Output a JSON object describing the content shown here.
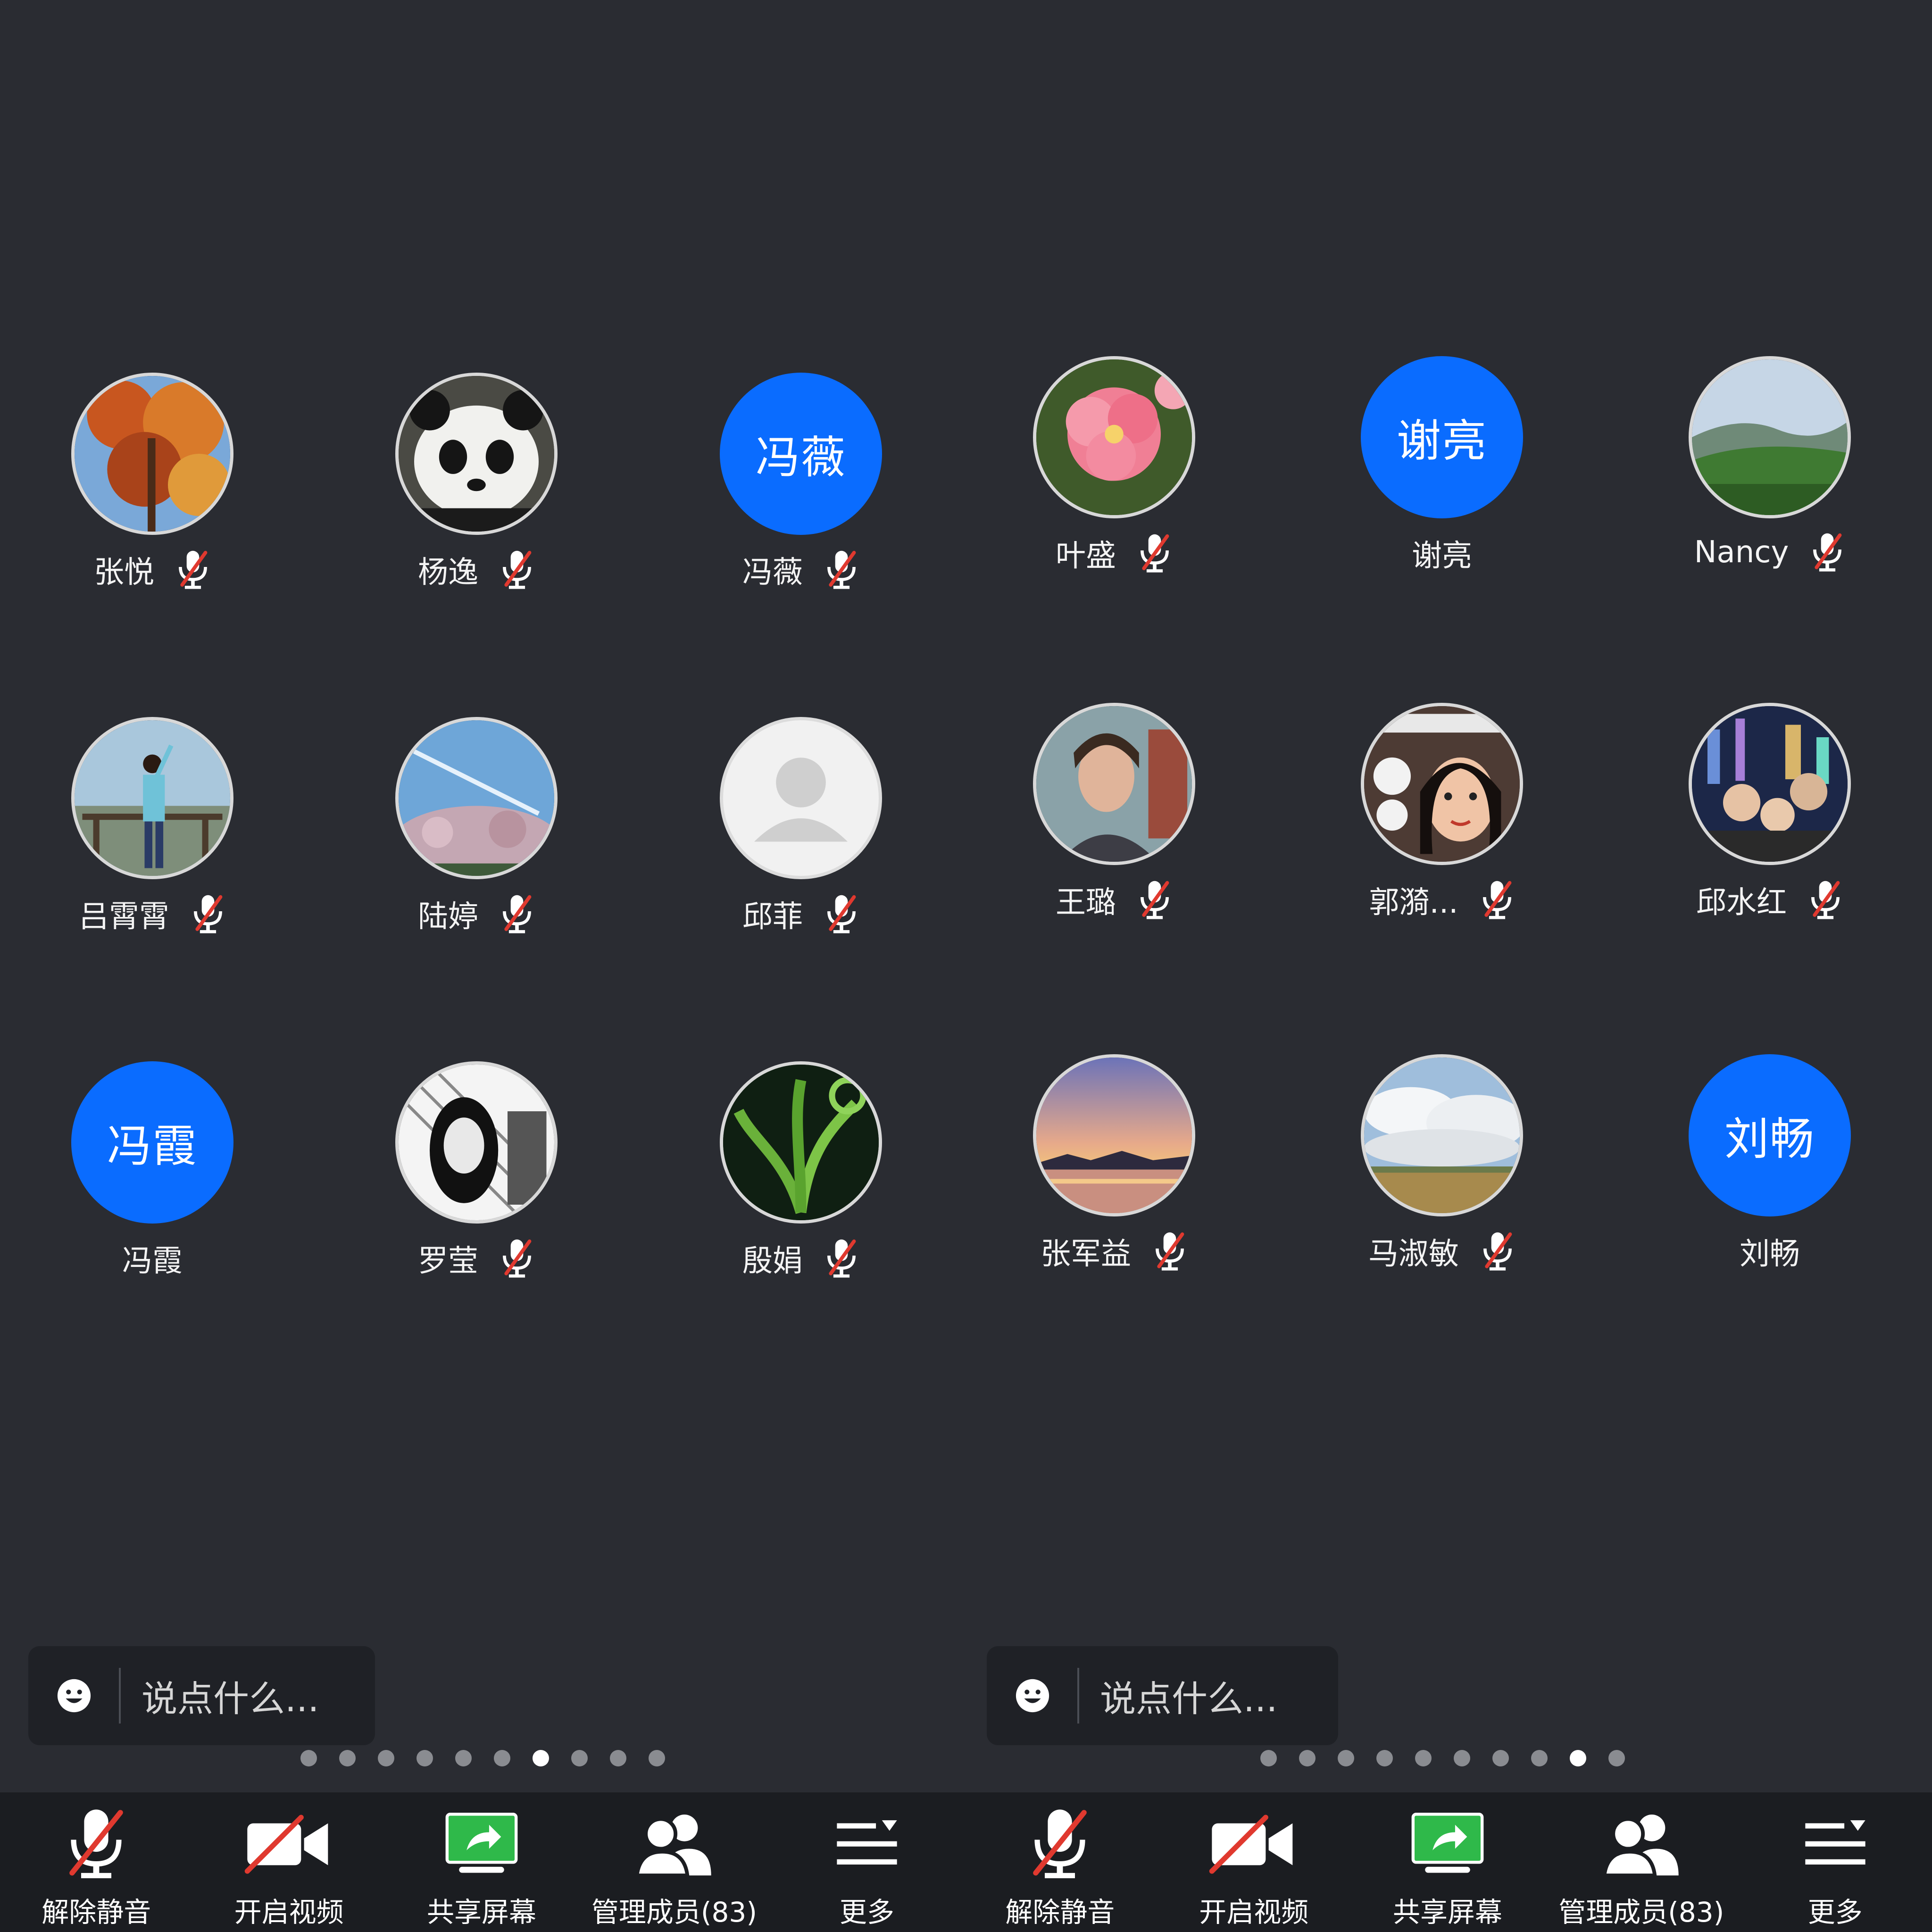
{
  "colors": {
    "background": "#2a2c32",
    "toolbar": "#1b1d21",
    "initials_avatar": "#0a6cff",
    "muted_slash": "#e0392f",
    "share_green": "#2fb94a"
  },
  "panels": [
    {
      "participants": [
        {
          "name": "张悦",
          "avatar": "photo-autumn-leaves",
          "muted": true
        },
        {
          "name": "杨逸",
          "avatar": "photo-panda",
          "muted": true
        },
        {
          "name": "冯薇",
          "avatar": "initials",
          "initials": "冯薇",
          "muted": true
        },
        {
          "name": "吕霄霄",
          "avatar": "photo-person-lookout",
          "muted": true
        },
        {
          "name": "陆婷",
          "avatar": "photo-blossom-sky",
          "muted": true
        },
        {
          "name": "邱菲",
          "avatar": "default-avatar",
          "muted": true
        },
        {
          "name": "冯霞",
          "avatar": "initials",
          "initials": "冯霞",
          "muted": false
        },
        {
          "name": "罗莹",
          "avatar": "photo-sketch-portrait",
          "muted": true
        },
        {
          "name": "殷娟",
          "avatar": "photo-green-plant",
          "muted": true
        }
      ],
      "chat": {
        "placeholder": "说点什么...",
        "icon": "smile-icon"
      },
      "pager": {
        "count": 10,
        "active_index": 6
      }
    },
    {
      "participants": [
        {
          "name": "叶盛",
          "avatar": "photo-pink-flower",
          "muted": true
        },
        {
          "name": "谢亮",
          "avatar": "initials",
          "initials": "谢亮",
          "muted": false
        },
        {
          "name": "Nancy",
          "avatar": "photo-hills",
          "muted": true
        },
        {
          "name": "王璐",
          "avatar": "photo-portrait",
          "muted": true
        },
        {
          "name": "郭漪...",
          "avatar": "photo-selfie",
          "muted": true
        },
        {
          "name": "邱水红",
          "avatar": "photo-family-city",
          "muted": true
        },
        {
          "name": "张军益",
          "avatar": "photo-sunset-lake",
          "muted": true
        },
        {
          "name": "马淑敏",
          "avatar": "photo-cloudy-field",
          "muted": true
        },
        {
          "name": "刘畅",
          "avatar": "initials",
          "initials": "刘畅",
          "muted": false
        }
      ],
      "chat": {
        "placeholder": "说点什么...",
        "icon": "smile-icon"
      },
      "pager": {
        "count": 10,
        "active_index": 8
      }
    }
  ],
  "toolbar": [
    {
      "label": "解除静音",
      "icon": "microphone-muted-icon"
    },
    {
      "label": "开启视频",
      "icon": "video-off-icon"
    },
    {
      "label": "共享屏幕",
      "icon": "share-screen-icon"
    },
    {
      "label": "管理成员(83)",
      "icon": "members-icon"
    },
    {
      "label": "更多",
      "icon": "more-menu-icon"
    }
  ]
}
